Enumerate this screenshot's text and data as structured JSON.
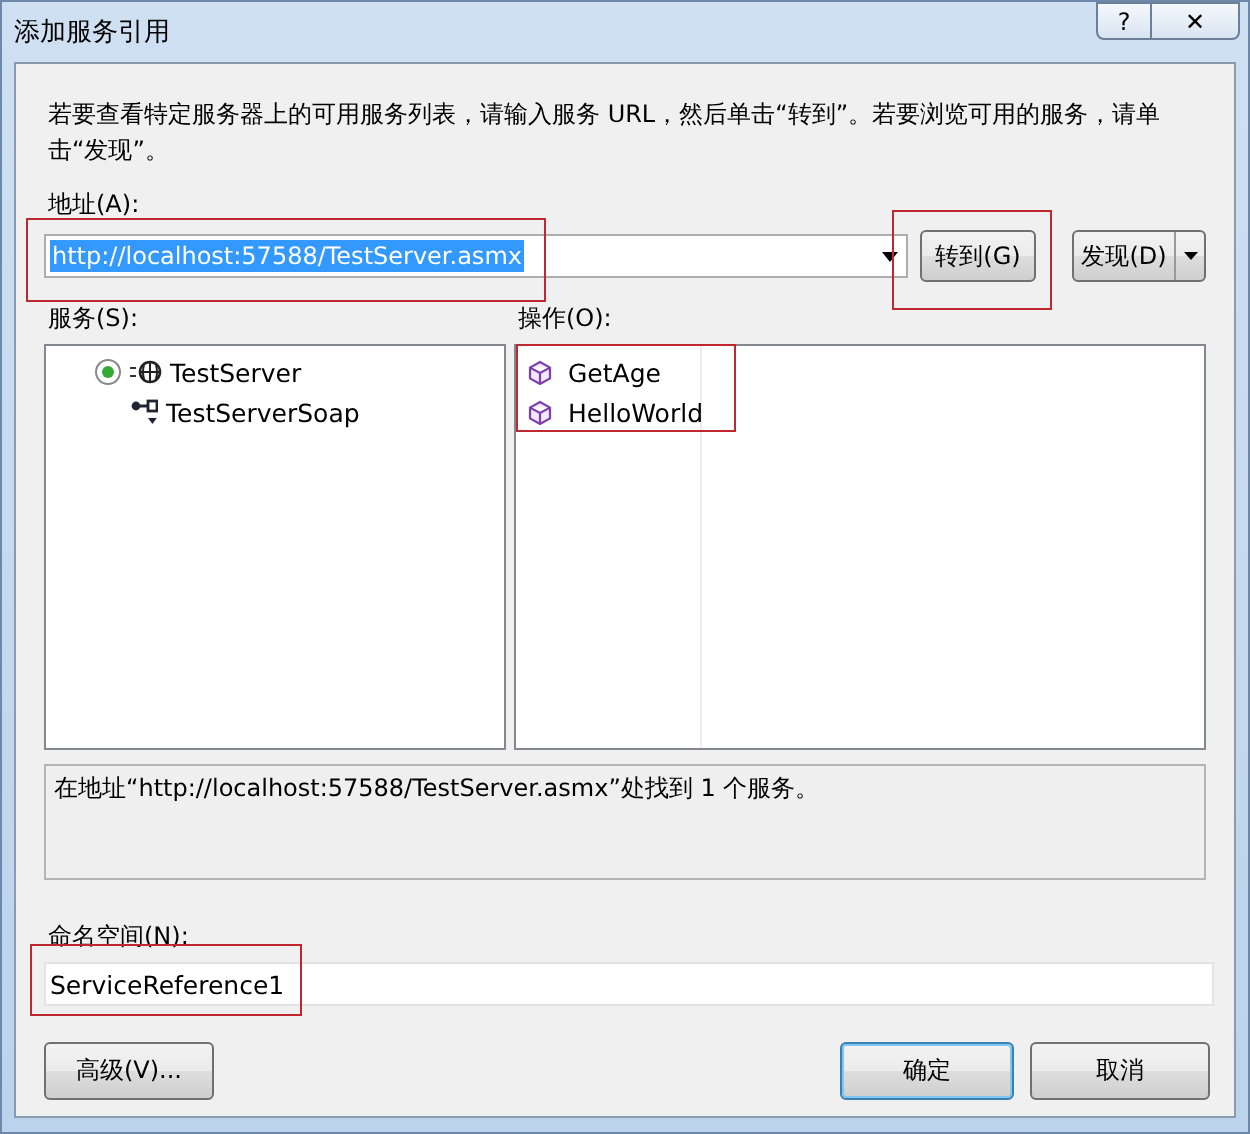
{
  "window": {
    "title": "添加服务引用",
    "help": "?",
    "close": "✕"
  },
  "description": "若要查看特定服务器上的可用服务列表，请输入服务 URL，然后单击“转到”。若要浏览可用的服务，请单击“发现”。",
  "address": {
    "label": "地址(A):",
    "value": "http://localhost:57588/TestServer.asmx",
    "highlighted": true
  },
  "go_button": {
    "label": "转到(G)",
    "highlighted": true
  },
  "discover_button": {
    "label": "发现(D)"
  },
  "services": {
    "label": "服务(S):",
    "tree": [
      {
        "name": "TestServer",
        "expanded": true,
        "children": [
          {
            "name": "TestServerSoap"
          }
        ]
      }
    ]
  },
  "operations": {
    "label": "操作(O):",
    "highlighted": true,
    "items": [
      "GetAge",
      "HelloWorld"
    ]
  },
  "status": "在地址“http://localhost:57588/TestServer.asmx”处找到 1 个服务。",
  "namespace": {
    "label": "命名空间(N):",
    "value": "ServiceReference1",
    "highlighted": true
  },
  "buttons": [
    {
      "label": "高级(V)...",
      "default": false
    },
    {
      "label": "确定",
      "default": true
    },
    {
      "label": "取消",
      "default": false
    }
  ]
}
